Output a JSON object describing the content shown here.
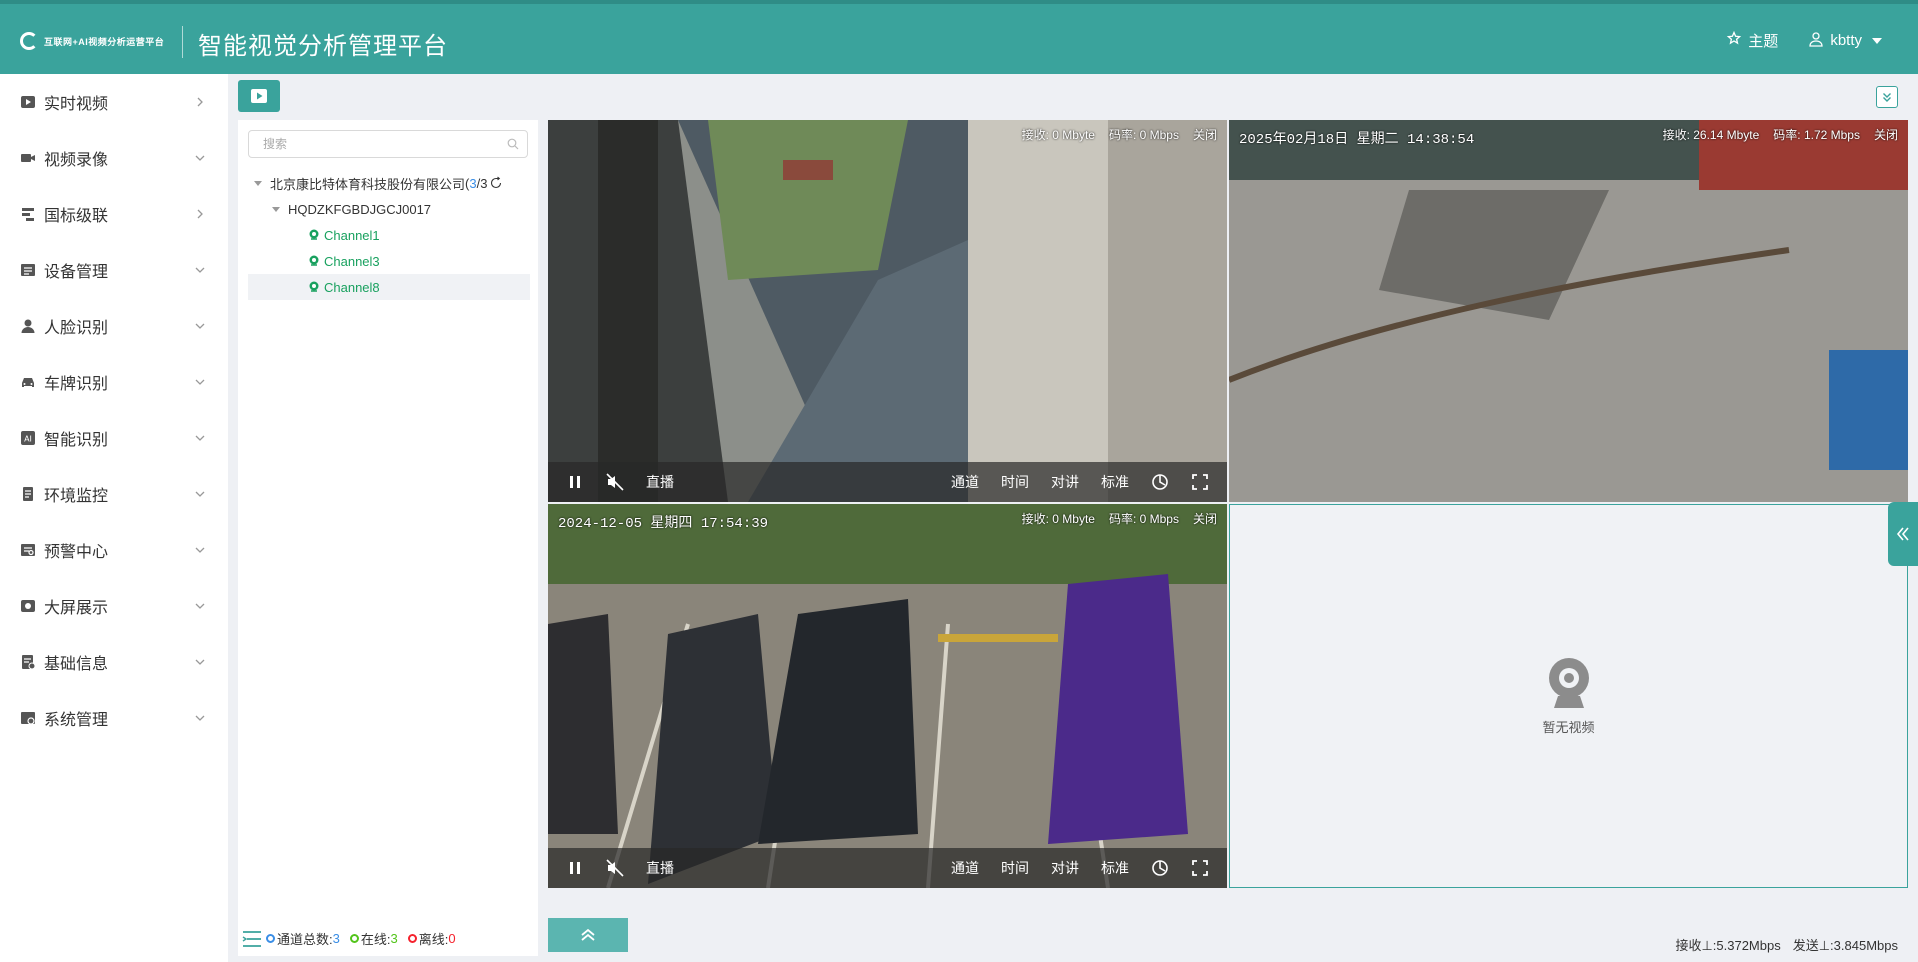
{
  "header": {
    "logo_text": "互联网+AI视频分析运营平台",
    "title": "智能视觉分析管理平台",
    "theme_label": "主题",
    "user_label": "kbtty"
  },
  "sidebar": {
    "items": [
      {
        "label": "实时视频",
        "icon": "video-play-icon",
        "arrow": "right"
      },
      {
        "label": "视频录像",
        "icon": "camera-icon",
        "arrow": "down"
      },
      {
        "label": "国标级联",
        "icon": "cascade-icon",
        "arrow": "right"
      },
      {
        "label": "设备管理",
        "icon": "device-icon",
        "arrow": "down"
      },
      {
        "label": "人脸识别",
        "icon": "face-icon",
        "arrow": "down"
      },
      {
        "label": "车牌识别",
        "icon": "car-icon",
        "arrow": "down"
      },
      {
        "label": "智能识别",
        "icon": "ai-icon",
        "arrow": "down"
      },
      {
        "label": "环境监控",
        "icon": "environment-icon",
        "arrow": "down"
      },
      {
        "label": "预警中心",
        "icon": "alert-icon",
        "arrow": "down"
      },
      {
        "label": "大屏展示",
        "icon": "screen-icon",
        "arrow": "down"
      },
      {
        "label": "基础信息",
        "icon": "info-icon",
        "arrow": "down"
      },
      {
        "label": "系统管理",
        "icon": "settings-icon",
        "arrow": "down"
      }
    ]
  },
  "tree": {
    "search_placeholder": "搜索",
    "org": {
      "name": "北京康比特体育科技股份有限公司",
      "count_prefix": " (",
      "online": "3",
      "sep": "/",
      "total": "3"
    },
    "device": "HQDZKFGBDJGCJ0017",
    "channels": [
      "Channel1",
      "Channel3",
      "Channel8"
    ],
    "footer": {
      "total_label": "通道总数:",
      "total_value": "3",
      "online_label": "在线:",
      "online_value": "3",
      "offline_label": "离线:",
      "offline_value": "0"
    }
  },
  "videos": [
    {
      "osd_time": "",
      "receive": "接收: 0 Mbyte",
      "bitrate": "码率: 0 Mbps",
      "close": "关闭",
      "controls": {
        "live": "直播",
        "channel": "通道",
        "time": "时间",
        "talk": "对讲",
        "quality": "标准"
      }
    },
    {
      "osd_time": "2025年02月18日 星期二 14:38:54",
      "receive": "接收: 26.14 Mbyte",
      "bitrate": "码率: 1.72 Mbps",
      "close": "关闭"
    },
    {
      "osd_time": "2024-12-05 星期四 17:54:39",
      "receive": "接收: 0 Mbyte",
      "bitrate": "码率: 0 Mbps",
      "close": "关闭",
      "controls": {
        "live": "直播",
        "channel": "通道",
        "time": "时间",
        "talk": "对讲",
        "quality": "标准"
      }
    },
    {
      "empty_text": "暂无视频"
    }
  ],
  "bandwidth": {
    "receive": "接收⊥:5.372Mbps",
    "send": "发送⊥:3.845Mbps"
  },
  "colors": {
    "primary": "#3aa39c",
    "online": "#52c41a",
    "offline": "#f5222d",
    "channel": "#19a15f",
    "link": "#3a8ee6"
  }
}
